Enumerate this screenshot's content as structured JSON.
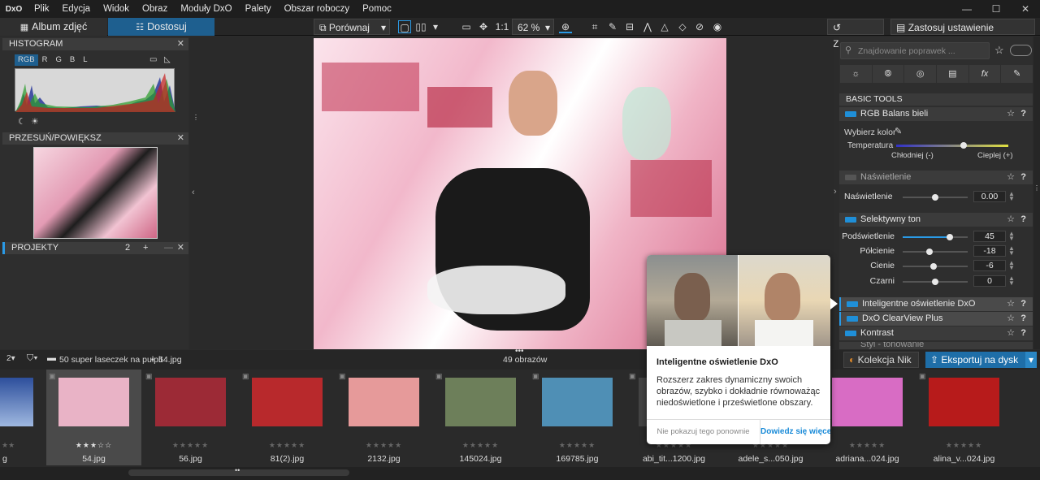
{
  "menubar": {
    "logo": "DxO",
    "items": [
      "Plik",
      "Edycja",
      "Widok",
      "Obraz",
      "Moduły DxO",
      "Palety",
      "Obszar roboczy",
      "Pomoc"
    ],
    "window_controls": [
      "—",
      "☐",
      "✕"
    ]
  },
  "toolbar": {
    "tab_library": "Album zdjęć",
    "tab_customize": "Dostosuj",
    "compare_label": "Porównaj",
    "ratio_label": "1:1",
    "zoom_value": "62 %",
    "reset_label": "Zresetuj",
    "apply_preset_label": "Zastosuj ustawienie wstępne"
  },
  "left": {
    "histogram_title": "HISTOGRAM",
    "hist_channels": [
      "RGB",
      "R",
      "G",
      "B",
      "L"
    ],
    "pan_title": "PRZESUŃ/POWIĘKSZ",
    "projects_title": "PROJEKTY",
    "projects_sort": "2",
    "projects_add": "+"
  },
  "right": {
    "search_placeholder": "Znajdowanie poprawek ...",
    "basic_tools": "BASIC TOOLS",
    "wb": {
      "title": "RGB Balans bieli",
      "pick_label": "Wybierz kolor",
      "temp_label": "Temperatura",
      "cooler": "Chłodniej (-)",
      "warmer": "Cieplej (+)",
      "temp_level": 0.6
    },
    "exposure": {
      "title": "Naświetlenie",
      "slider_label": "Naświetlenie",
      "value": "0.00",
      "level": 0.5
    },
    "selective": {
      "title": "Selektywny ton",
      "rows": [
        {
          "label": "Podświetlenie",
          "value": "45",
          "level": 0.725
        },
        {
          "label": "Półcienie",
          "value": "-18",
          "level": 0.41
        },
        {
          "label": "Cienie",
          "value": "-6",
          "level": 0.47
        },
        {
          "label": "Czarni",
          "value": "0",
          "level": 0.5
        }
      ]
    },
    "sections_below": [
      {
        "title": "Inteligentne oświetlenie DxO"
      },
      {
        "title": "DxO ClearView Plus"
      },
      {
        "title": "Kontrast"
      },
      {
        "title": "Styl - tonowanie"
      }
    ],
    "nik_label": "Kolekcja Nik",
    "export_label": "Eksportuj na dysk"
  },
  "filmbar": {
    "sort_label": "2",
    "folder_path": "50 super laseczek na pulpit",
    "current_file": "54.jpg",
    "count_label": "49 obrazów"
  },
  "filmstrip": {
    "first_fn": "g",
    "items": [
      {
        "fn": "54.jpg",
        "stars": "★★★☆☆",
        "color": "#e9b3c6",
        "selected": true
      },
      {
        "fn": "56.jpg",
        "stars": "★★★★★",
        "color": "#9c2a36",
        "selected": false
      },
      {
        "fn": "81(2).jpg",
        "stars": "★★★★★",
        "color": "#b8292c",
        "selected": false
      },
      {
        "fn": "2132.jpg",
        "stars": "★★★★★",
        "color": "#e69a9a",
        "selected": false
      },
      {
        "fn": "145024.jpg",
        "stars": "★★★★★",
        "color": "#6d7f5a",
        "selected": false
      },
      {
        "fn": "169785.jpg",
        "stars": "★★★★★",
        "color": "#4f8fb5",
        "selected": false
      },
      {
        "fn": "abi_tit...1200.jpg",
        "stars": "★★★★★",
        "color": "#444",
        "selected": false
      },
      {
        "fn": "adele_s...050.jpg",
        "stars": "★★★★★",
        "color": "#c9a0a0",
        "selected": false
      },
      {
        "fn": "adriana...024.jpg",
        "stars": "★★★★★",
        "color": "#d86cc4",
        "selected": false
      },
      {
        "fn": "alina_v...024.jpg",
        "stars": "★★★★★",
        "color": "#b71b1b",
        "selected": false
      }
    ]
  },
  "popup": {
    "title": "Inteligentne oświetlenie DxO",
    "body": "Rozszerz zakres dynamiczny swoich obrazów, szybko i dokładnie równoważąc niedoświetlone i prześwietlone obszary.",
    "dismiss": "Nie pokazuj tego ponownie",
    "learn_more": "Dowiedz się więcej"
  },
  "colors": {
    "accent": "#1f8fd8",
    "tab_active": "#1e5f8f"
  }
}
